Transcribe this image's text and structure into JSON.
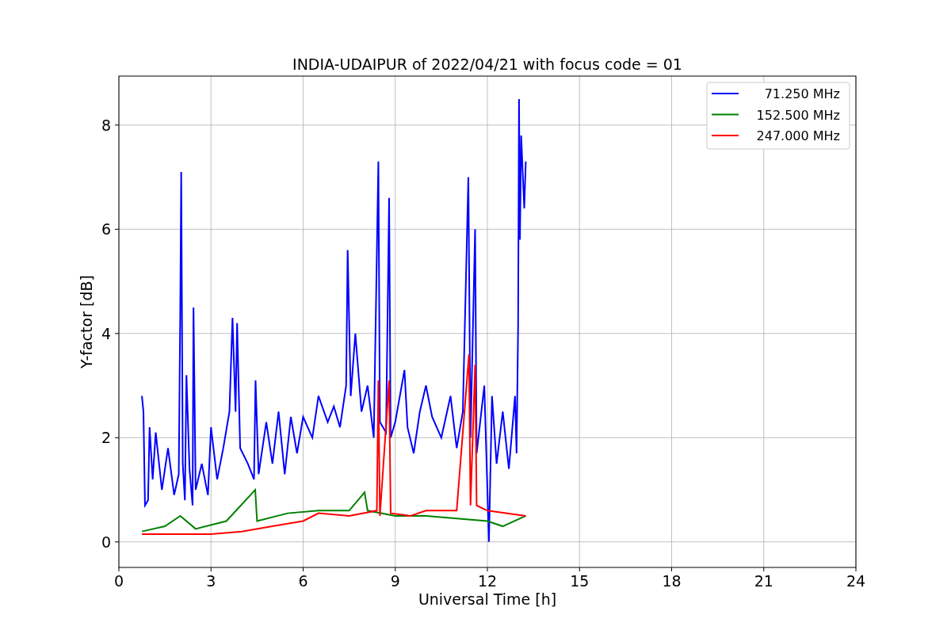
{
  "figure": {
    "chart_data": {
      "type": "line",
      "title": "INDIA-UDAIPUR of 2022/04/21 with focus code = 01",
      "xlabel": "Universal Time [h]",
      "ylabel": "Y-factor [dB]",
      "xlim": [
        0,
        24
      ],
      "ylim": [
        -0.49,
        8.94
      ],
      "xticks": [
        0,
        3,
        6,
        9,
        12,
        15,
        18,
        21,
        24
      ],
      "yticks": [
        0,
        2,
        4,
        6,
        8
      ],
      "grid": true,
      "legend": "upper right",
      "series": [
        {
          "name": "71.250 MHz",
          "color": "#0000ff",
          "x": [
            0.75,
            0.8,
            0.85,
            0.95,
            1.0,
            1.1,
            1.2,
            1.4,
            1.6,
            1.8,
            1.95,
            2.0,
            2.03,
            2.08,
            2.15,
            2.2,
            2.3,
            2.4,
            2.43,
            2.5,
            2.7,
            2.9,
            3.0,
            3.2,
            3.4,
            3.6,
            3.7,
            3.8,
            3.85,
            3.95,
            4.2,
            4.4,
            4.45,
            4.55,
            4.8,
            5.0,
            5.2,
            5.4,
            5.6,
            5.8,
            6.0,
            6.3,
            6.5,
            6.8,
            7.0,
            7.2,
            7.4,
            7.45,
            7.55,
            7.7,
            7.9,
            8.1,
            8.3,
            8.45,
            8.5,
            8.7,
            8.8,
            8.85,
            9.0,
            9.3,
            9.4,
            9.6,
            9.8,
            10.0,
            10.2,
            10.5,
            10.8,
            11.0,
            11.2,
            11.38,
            11.45,
            11.6,
            11.65,
            11.9,
            12.05,
            12.15,
            12.3,
            12.5,
            12.7,
            12.9,
            12.95,
            13.0,
            13.03,
            13.06,
            13.1,
            13.2,
            13.25
          ],
          "values": [
            2.8,
            2.5,
            0.7,
            0.8,
            2.2,
            1.2,
            2.1,
            1.0,
            1.8,
            0.9,
            1.3,
            4.5,
            7.1,
            1.5,
            0.8,
            3.2,
            1.4,
            0.7,
            4.5,
            1.0,
            1.5,
            0.9,
            2.2,
            1.2,
            1.8,
            2.5,
            4.3,
            2.5,
            4.2,
            1.8,
            1.5,
            1.2,
            3.1,
            1.3,
            2.3,
            1.5,
            2.5,
            1.3,
            2.4,
            1.7,
            2.4,
            2.0,
            2.8,
            2.3,
            2.6,
            2.2,
            3.0,
            5.6,
            2.8,
            4.0,
            2.5,
            3.0,
            2.0,
            7.3,
            2.3,
            2.1,
            6.6,
            2.0,
            2.3,
            3.3,
            2.2,
            1.7,
            2.5,
            3.0,
            2.4,
            2.0,
            2.8,
            1.8,
            2.5,
            7.0,
            2.0,
            6.0,
            1.7,
            3.0,
            0.0,
            2.8,
            1.5,
            2.5,
            1.4,
            2.8,
            1.7,
            4.1,
            8.5,
            5.8,
            7.8,
            6.4,
            7.3
          ]
        },
        {
          "name": "152.500 MHz",
          "color": "#008000",
          "x": [
            0.75,
            1.5,
            2.0,
            2.5,
            3.5,
            4.44,
            4.5,
            5.5,
            6.5,
            7.5,
            8.0,
            8.1,
            9.0,
            10.0,
            11.0,
            12.0,
            12.5,
            13.25
          ],
          "values": [
            0.2,
            0.3,
            0.5,
            0.25,
            0.4,
            1.0,
            0.4,
            0.55,
            0.6,
            0.6,
            0.95,
            0.6,
            0.5,
            0.5,
            0.45,
            0.4,
            0.3,
            0.5
          ]
        },
        {
          "name": "247.000 MHz",
          "color": "#ff0000",
          "x": [
            0.75,
            2.0,
            3.0,
            4.0,
            5.0,
            6.0,
            6.5,
            7.5,
            8.4,
            8.45,
            8.5,
            8.8,
            8.85,
            9.5,
            10.0,
            11.0,
            11.4,
            11.45,
            11.6,
            11.65,
            12.0,
            13.25
          ],
          "values": [
            0.15,
            0.15,
            0.15,
            0.2,
            0.3,
            0.4,
            0.55,
            0.5,
            0.6,
            3.1,
            0.5,
            3.1,
            0.55,
            0.5,
            0.6,
            0.6,
            3.6,
            0.7,
            3.4,
            0.7,
            0.6,
            0.5
          ]
        }
      ]
    }
  }
}
